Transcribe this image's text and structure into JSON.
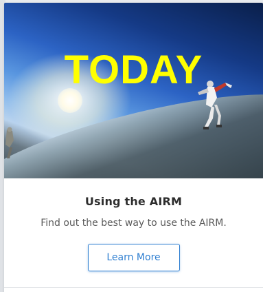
{
  "hero": {
    "overlay_text": "TODAY",
    "overlay_color": "#ffff00"
  },
  "card": {
    "title": "Using the AIRM",
    "description": "Find out the best way to use the AIRM.",
    "button_label": "Learn More",
    "accent_color": "#2f7fd1"
  },
  "icons": {
    "hero_image": "skydiver-photo"
  }
}
